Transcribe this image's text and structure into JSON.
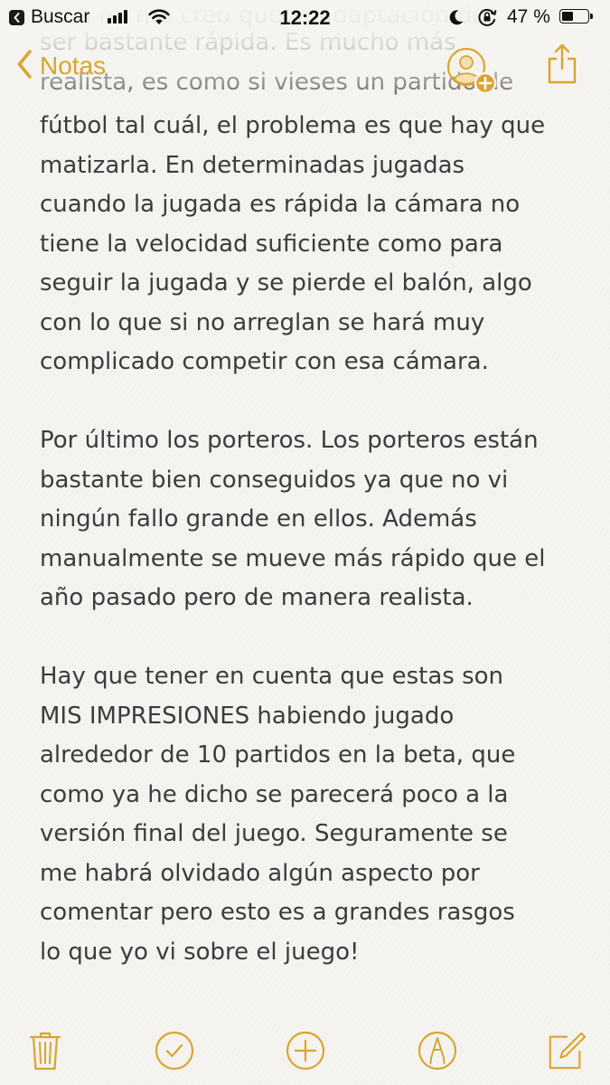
{
  "status_bar": {
    "back_app": "Buscar",
    "time": "12:22",
    "battery_percent": "47 %",
    "battery_level": 0.47,
    "signal_bars": 4,
    "icons": [
      "chevron-left-icon",
      "signal-icon",
      "wifi-icon",
      "moon-icon",
      "rotation-lock-icon",
      "battery-icon"
    ]
  },
  "nav": {
    "back_label": "Notas",
    "accent_color": "#d9a52c",
    "icons": [
      "chevron-left-icon",
      "add-person-icon",
      "share-icon"
    ]
  },
  "note": {
    "hidden_top_lines": [
      "no a mi me creo que la adaptación de",
      "ser bastante rápida. Es mucho más",
      "realista, es como si vieses un partido de"
    ],
    "lines": [
      "fútbol tal cuál, el problema es que hay que",
      "matizarla. En determinadas jugadas",
      "cuando la jugada es rápida la cámara no",
      "tiene la velocidad suficiente como para",
      "seguir la jugada y se pierde el balón, algo",
      "con lo que si no arreglan se hará muy",
      "complicado competir con esa cámara.",
      "",
      "Por último los porteros. Los porteros están",
      "bastante bien conseguidos ya que no vi",
      "ningún fallo grande en ellos. Además",
      "manualmente se mueve más rápido que el",
      "año pasado pero de manera realista.",
      "",
      "Hay que tener en cuenta que estas son",
      "MIS IMPRESIONES habiendo jugado",
      "alrededor de 10 partidos en la beta, que",
      "como ya he dicho se parecerá poco a la",
      "versión final del juego. Seguramente se",
      "me habrá olvidado algún aspecto por",
      "comentar pero esto es a grandes rasgos",
      "lo que yo vi sobre el juego!"
    ]
  },
  "toolbar": {
    "icons": [
      "trash-icon",
      "checklist-icon",
      "add-icon",
      "markup-icon",
      "compose-icon"
    ]
  }
}
